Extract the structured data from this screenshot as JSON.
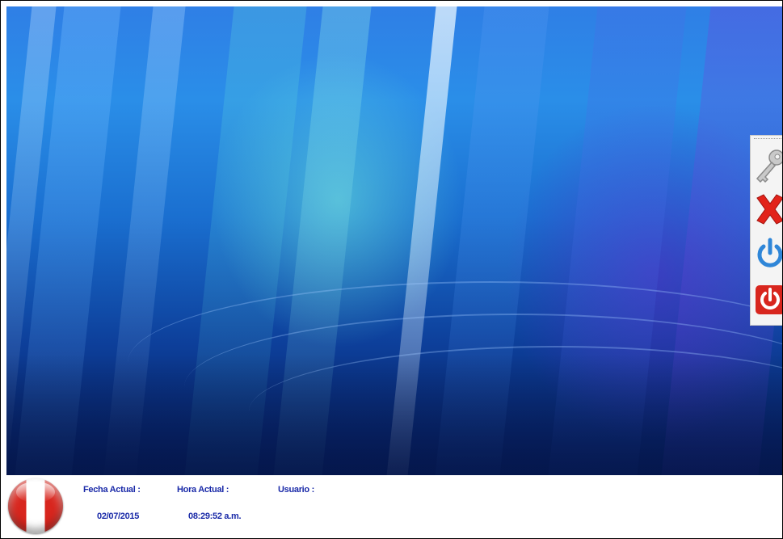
{
  "desktop": {
    "toolbar": {
      "buttons": [
        {
          "name": "key-button",
          "icon": "key-icon",
          "color": "#b0b0b0"
        },
        {
          "name": "close-button",
          "icon": "close-x-icon",
          "color": "#e2231a"
        },
        {
          "name": "logoff-button",
          "icon": "power-blue-icon",
          "color": "#2f86d8"
        },
        {
          "name": "shutdown-button",
          "icon": "power-red-icon",
          "color": "#d8261e"
        }
      ]
    }
  },
  "status": {
    "flag_icon": "peru-flag-icon",
    "date_label": "Fecha Actual :",
    "date_value": "02/07/2015",
    "time_label": "Hora Actual :",
    "time_value": "08:29:52 a.m.",
    "user_label": "Usuario :",
    "user_value": ""
  }
}
